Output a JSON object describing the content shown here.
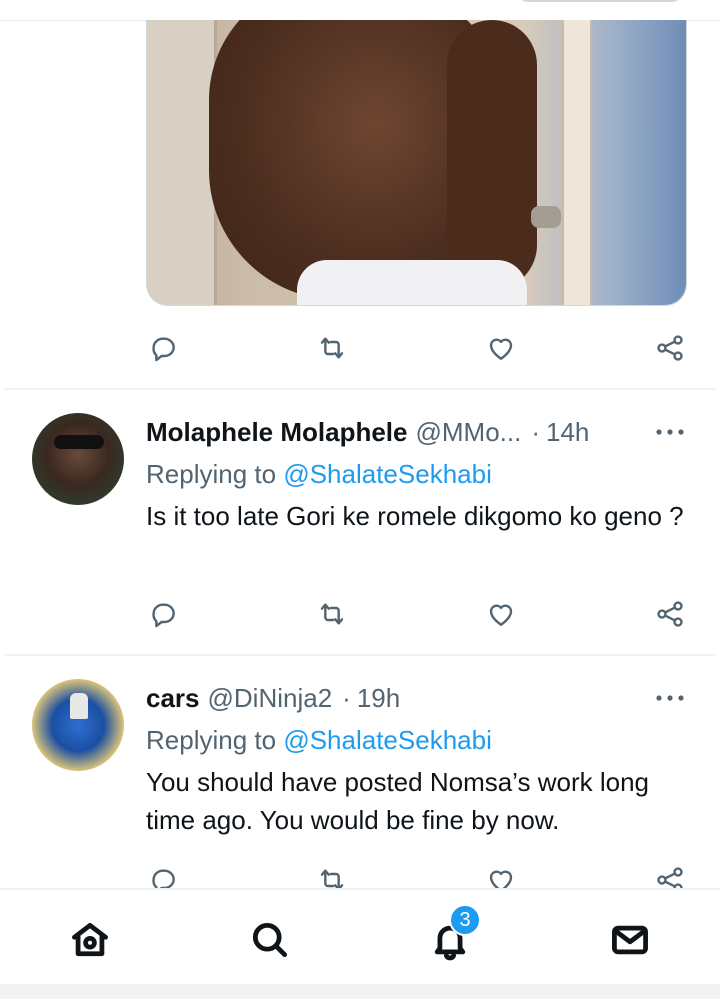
{
  "tweets": [
    {
      "name": "Molaphele Molaphele",
      "handle": "@MMo...",
      "separator": "·",
      "time": "14h",
      "replying_prefix": "Replying to ",
      "replying_to": "@ShalateSekhabi",
      "text": "Is it too late Gori ke romele dikgomo ko geno ?"
    },
    {
      "name": "cars",
      "handle": "@DiNinja2",
      "separator": "·",
      "time": "19h",
      "replying_prefix": "Replying to ",
      "replying_to": "@ShalateSekhabi",
      "text": "You should have posted Nomsa’s work long time ago. You would be fine by now."
    }
  ],
  "actions": [
    "reply-icon",
    "retweet-icon",
    "like-icon",
    "share-icon"
  ],
  "bottom_nav": {
    "items": [
      "home-icon",
      "search-icon",
      "notifications-icon",
      "messages-icon"
    ],
    "notifications_badge": "3"
  },
  "colors": {
    "link": "#1d9bf0",
    "muted": "#536471",
    "text": "#0f1419",
    "badge": "#1d9bf0"
  }
}
